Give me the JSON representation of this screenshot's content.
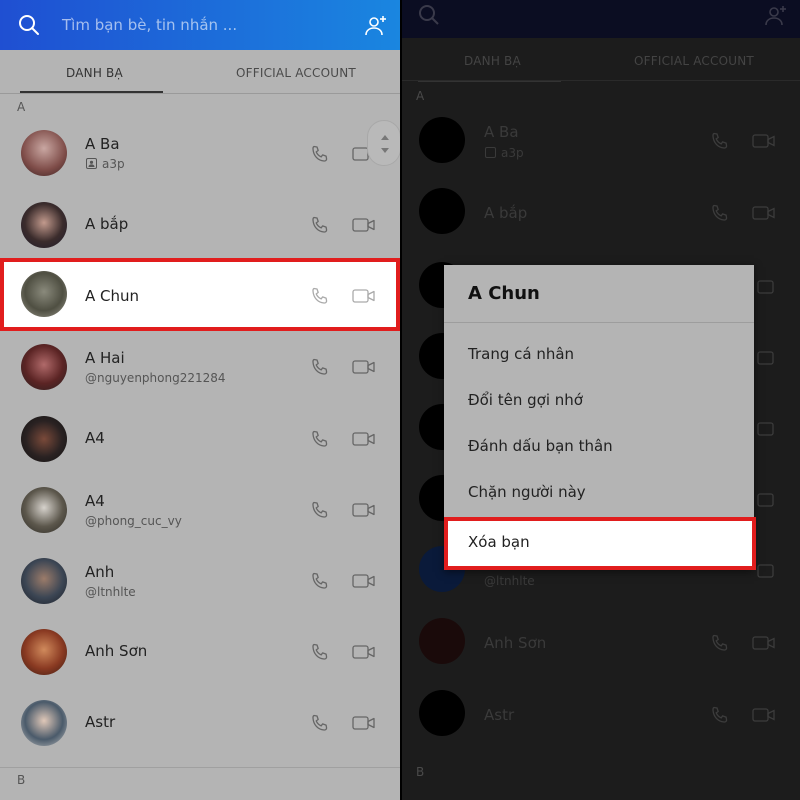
{
  "search": {
    "placeholder": "Tìm bạn bè, tin nhắn ..."
  },
  "tabs": [
    {
      "label": "DANH BẠ",
      "active": true
    },
    {
      "label": "OFFICIAL ACCOUNT",
      "active": false
    }
  ],
  "sections": {
    "a": "A",
    "b": "B"
  },
  "contacts": [
    {
      "name": "A Ba",
      "sub": "a3p",
      "sub_icon": "contact-card-icon",
      "highlighted": false
    },
    {
      "name": "A bắp",
      "sub": "",
      "highlighted": false
    },
    {
      "name": "A Chun",
      "sub": "",
      "highlighted": true
    },
    {
      "name": "A Hai",
      "sub": "@nguyenphong221284",
      "highlighted": false
    },
    {
      "name": "A4",
      "sub": "",
      "highlighted": false
    },
    {
      "name": "A4",
      "sub": "@phong_cuc_vy",
      "highlighted": false
    },
    {
      "name": "Anh",
      "sub": "@ltnhlte",
      "highlighted": false
    },
    {
      "name": "Anh Sơn",
      "sub": "",
      "highlighted": false
    },
    {
      "name": "Astr",
      "sub": "",
      "highlighted": false
    }
  ],
  "dialog": {
    "title": "A Chun",
    "items": [
      {
        "label": "Trang cá nhân"
      },
      {
        "label": "Đổi tên gợi nhớ"
      },
      {
        "label": "Đánh dấu bạn thân"
      },
      {
        "label": "Chặn người này"
      },
      {
        "label": "Xóa bạn",
        "highlighted": true
      }
    ]
  },
  "right_panel": {
    "visible_contacts": [
      {
        "name": "A Ba",
        "sub": "a3p"
      },
      {
        "name": "A bắp",
        "sub": ""
      },
      {
        "name": "@ltnhlte",
        "sub": ""
      },
      {
        "name": "Anh Sơn",
        "sub": ""
      },
      {
        "name": "Astr",
        "sub": ""
      }
    ]
  },
  "colors": {
    "header_gradient_start": "#1f4fd2",
    "header_gradient_end": "#1a86e0",
    "highlight_border": "#e11d1d",
    "overlay_left": "#b4b4b4",
    "overlay_right": "#1c1c1c"
  }
}
